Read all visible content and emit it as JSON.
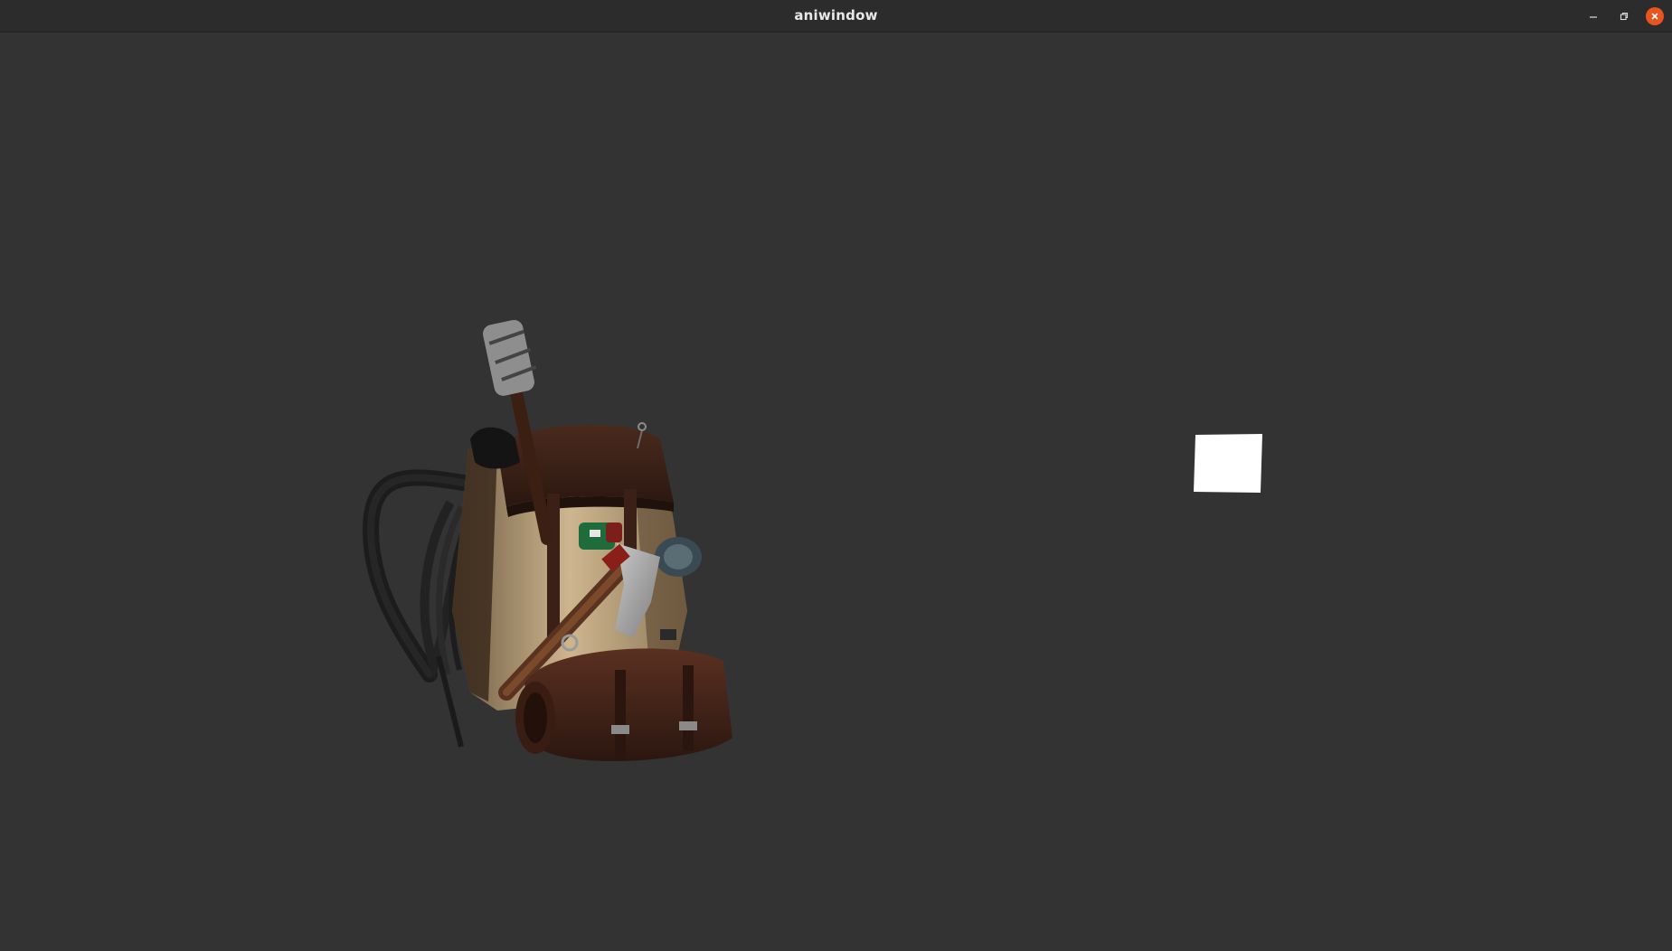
{
  "window": {
    "title": "aniwindow",
    "controls": {
      "minimize_icon": "minimize-icon",
      "maximize_icon": "restore-icon",
      "close_icon": "close-icon"
    },
    "accent_colors": {
      "close": "#e9541f",
      "background": "#333333",
      "titlebar": "#2c2c2c"
    }
  }
}
